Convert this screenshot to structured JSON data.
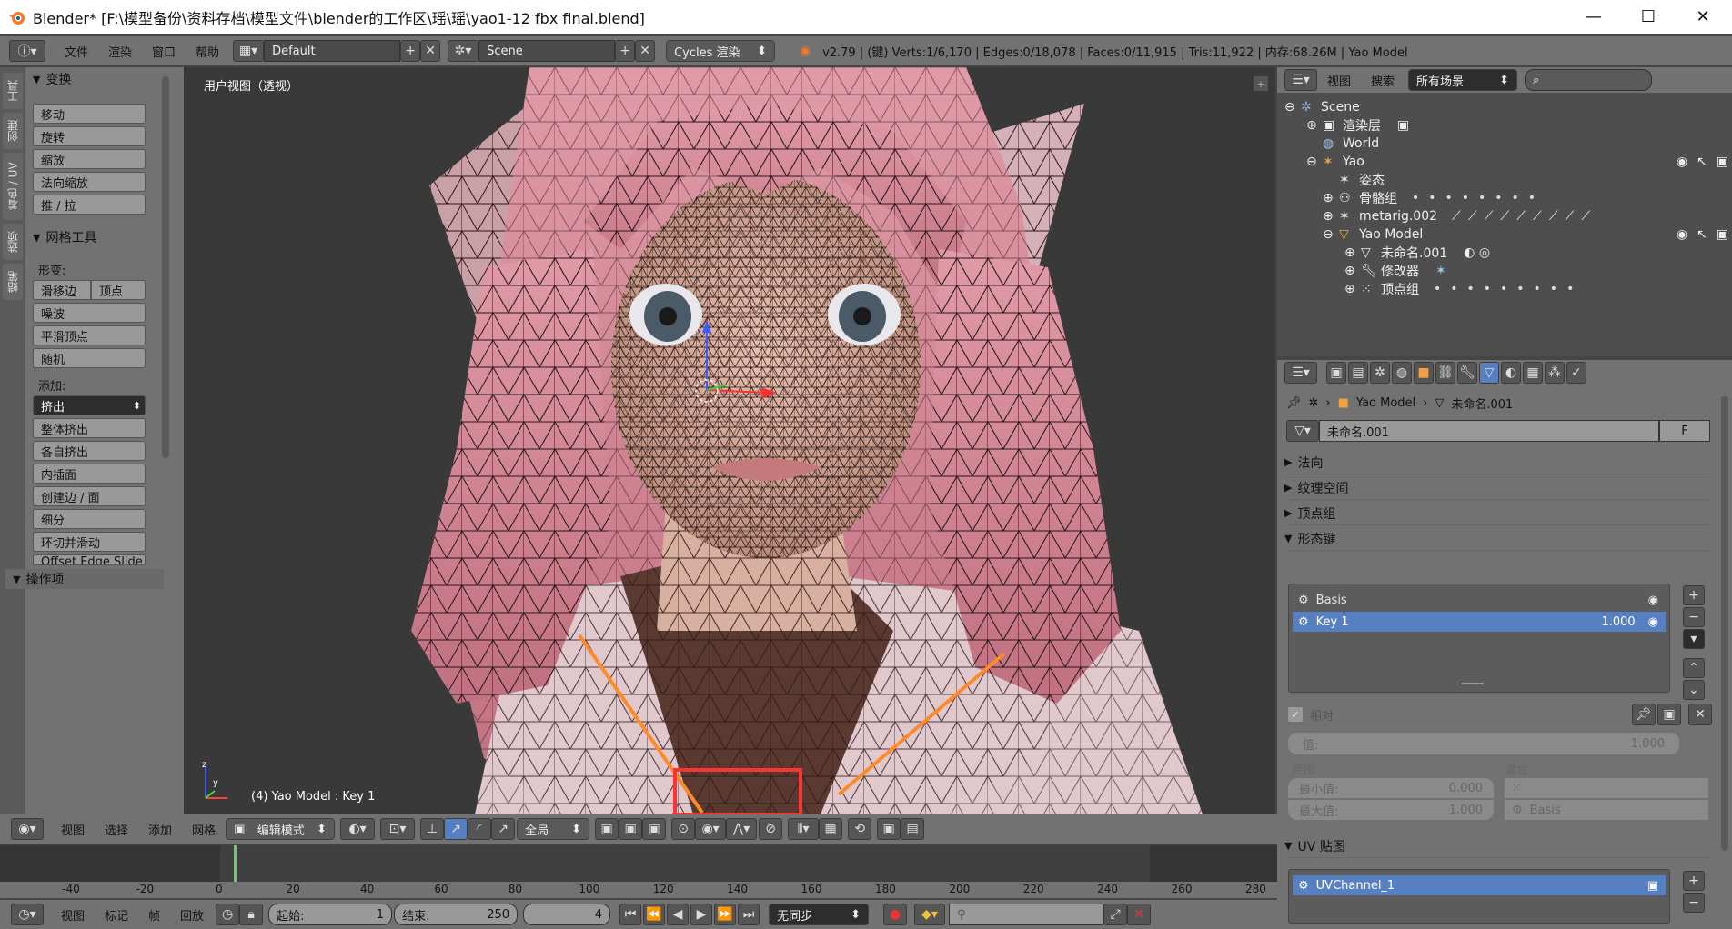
{
  "window": {
    "title": "Blender* [F:\\模型备份\\资料存档\\模型文件\\blender的工作区\\瑶\\瑶\\yao1-12 fbx final.blend]",
    "min": "—",
    "max": "☐",
    "close": "✕"
  },
  "menubar": {
    "items": [
      "文件",
      "渲染",
      "窗口",
      "帮助"
    ],
    "layout": "Default",
    "scene": "Scene",
    "engine": "Cycles 渲染",
    "stats": "v2.79 | (键) Verts:1/6,170 | Edges:0/18,078 | Faces:0/11,915 | Tris:11,922 | 内存:68.26M | Yao Model"
  },
  "left_tabs": [
    "工具",
    "创建",
    "着色 / UV",
    "选项",
    "蜡笔"
  ],
  "shelf": {
    "transform_title": "变换",
    "transform_buttons": [
      "移动",
      "旋转",
      "缩放",
      "法向缩放",
      "推 / 拉"
    ],
    "mesh_tools_title": "网格工具",
    "deform_label": "形变:",
    "slide_edge": "滑移边",
    "vertex": "顶点",
    "deform_buttons": [
      "噪波",
      "平滑顶点",
      "随机"
    ],
    "add_label": "添加:",
    "extrude": "挤出",
    "add_buttons": [
      "整体挤出",
      "各自挤出",
      "内插面",
      "创建边 / 面",
      "细分",
      "环切并滑动",
      "Offset Edge Slide"
    ],
    "operator_title": "操作项"
  },
  "viewport": {
    "label": "用户视图（透视）",
    "status": "(4) Yao Model : Key 1",
    "axes": {
      "z": "z",
      "y": "y",
      "x": "x"
    }
  },
  "view3d_header": {
    "items": [
      "视图",
      "选择",
      "添加",
      "网格"
    ],
    "mode": "编辑模式",
    "orientation": "全局"
  },
  "outliner": {
    "menu": [
      "视图",
      "搜索"
    ],
    "filter": "所有场景",
    "rows": [
      {
        "label": "Scene",
        "level": 0
      },
      {
        "label": "渲染层",
        "level": 1
      },
      {
        "label": "World",
        "level": 1
      },
      {
        "label": "Yao",
        "level": 1
      },
      {
        "label": "姿态",
        "level": 2
      },
      {
        "label": "骨骼组",
        "level": 2
      },
      {
        "label": "metarig.002",
        "level": 2
      },
      {
        "label": "Yao Model",
        "level": 2
      },
      {
        "label": "未命名.001",
        "level": 3
      },
      {
        "label": "修改器",
        "level": 3
      },
      {
        "label": "顶点组",
        "level": 3
      }
    ]
  },
  "properties": {
    "breadcrumb": [
      "Yao Model",
      "未命名.001"
    ],
    "mesh_name": "未命名.001",
    "fake_user": "F",
    "sections": [
      "法向",
      "纹理空间",
      "顶点组",
      "形态键"
    ],
    "shape_keys": [
      {
        "name": "Basis",
        "value": ""
      },
      {
        "name": "Key 1",
        "value": "1.000"
      }
    ],
    "relative": "相对",
    "value_label": "值:",
    "value": "1.000",
    "range_label": "范围:",
    "blend_label": "混合:",
    "min_label": "最小值:",
    "min": "0.000",
    "max_label": "最大值:",
    "max": "1.000",
    "blend_value": "Basis",
    "uv_title": "UV 贴图",
    "uv_channel": "UVChannel_1"
  },
  "timeline": {
    "ticks": [
      "-40",
      "-20",
      "0",
      "20",
      "40",
      "60",
      "80",
      "100",
      "120",
      "140",
      "160",
      "180",
      "200",
      "220",
      "240",
      "260",
      "280"
    ],
    "current_frame": 4,
    "menu": [
      "视图",
      "标记",
      "帧",
      "回放"
    ],
    "start_label": "起始:",
    "start": "1",
    "end_label": "结束:",
    "end": "250",
    "frame": "4",
    "sync": "无同步"
  },
  "colors": {
    "selected": "#5680c2",
    "highlight_box": "#ff3333",
    "arrow": "#ff8a2a",
    "bg": "#454545"
  }
}
